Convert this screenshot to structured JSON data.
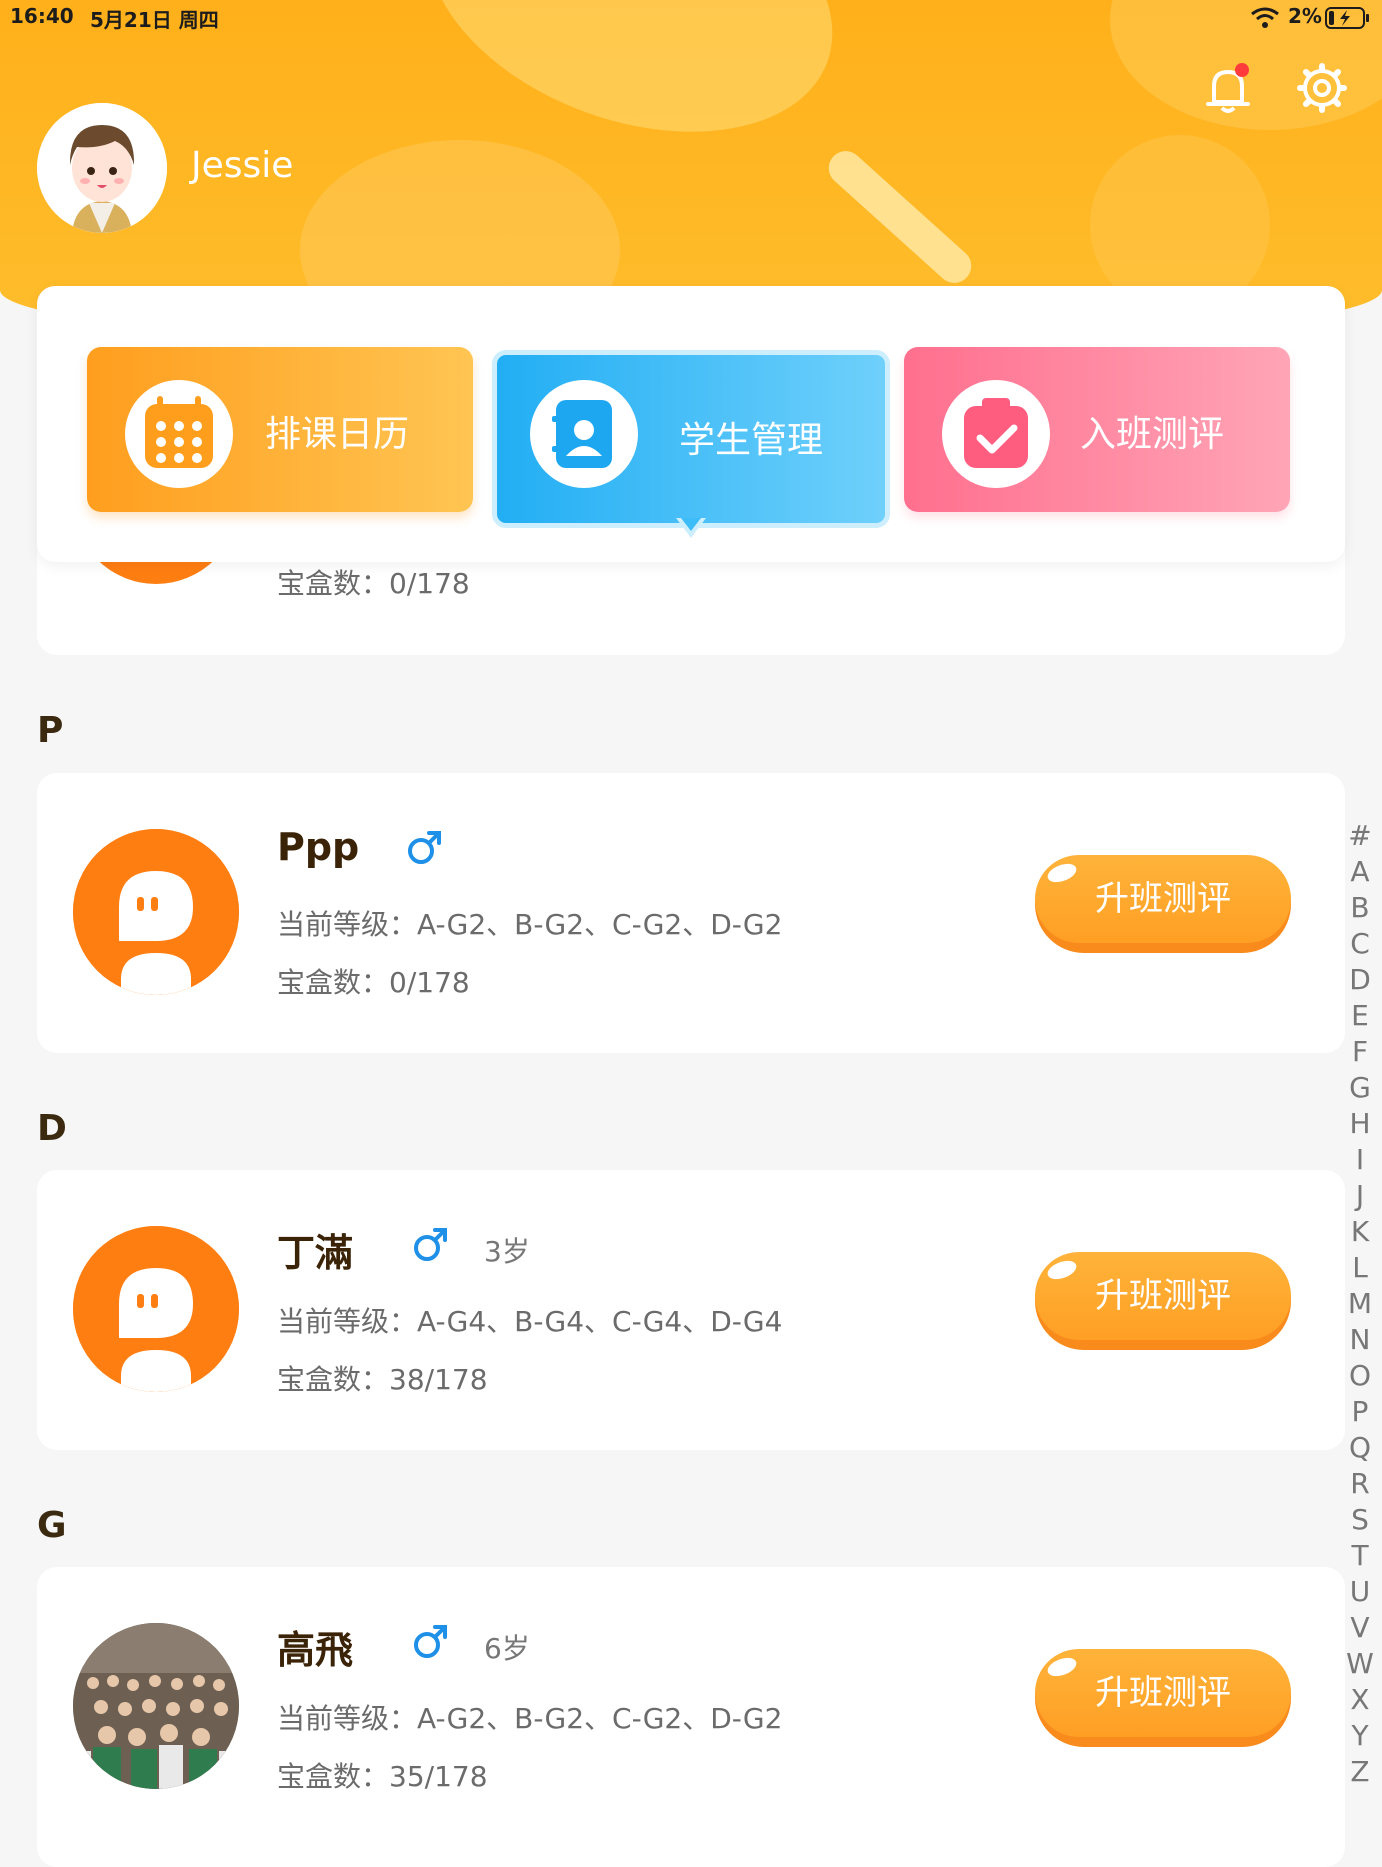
{
  "status_bar": {
    "time": "16:40",
    "date": "5月21日 周四",
    "battery": "2%"
  },
  "profile": {
    "name": "Jessie"
  },
  "menu": [
    {
      "label": "排课日历",
      "icon": "calendar-icon",
      "active": false
    },
    {
      "label": "学生管理",
      "icon": "contacts-icon",
      "active": true
    },
    {
      "label": "入班测评",
      "icon": "clipboard-check-icon",
      "active": false
    }
  ],
  "partial_card": {
    "boxes": "宝盒数：0/178"
  },
  "sections": [
    {
      "letter": "P",
      "student": {
        "name": "Ppp",
        "gender": "♂",
        "age": "",
        "level": "当前等级：A-G2、B-G2、C-G2、D-G2",
        "boxes": "宝盒数：0/178",
        "button": "升班测评"
      }
    },
    {
      "letter": "D",
      "student": {
        "name": "丁滿",
        "gender": "♂",
        "age": "3岁",
        "level": "当前等级：A-G4、B-G4、C-G4、D-G4",
        "boxes": "宝盒数：38/178",
        "button": "升班测评"
      }
    },
    {
      "letter": "G",
      "student": {
        "name": "高飛",
        "gender": "♂",
        "age": "6岁",
        "level": "当前等级：A-G2、B-G2、C-G2、D-G2",
        "boxes": "宝盒数：35/178",
        "button": "升班测评"
      }
    }
  ],
  "index_letters": [
    "#",
    "A",
    "B",
    "C",
    "D",
    "E",
    "F",
    "G",
    "H",
    "I",
    "J",
    "K",
    "L",
    "M",
    "N",
    "O",
    "P",
    "Q",
    "R",
    "S",
    "T",
    "U",
    "V",
    "W",
    "X",
    "Y",
    "Z"
  ],
  "colors": {
    "header": "#ffb01a",
    "accent_orange": "#ff9f24",
    "blue": "#2db3f5",
    "pink": "#ff7b98",
    "gender_male": "#1e90e8"
  }
}
